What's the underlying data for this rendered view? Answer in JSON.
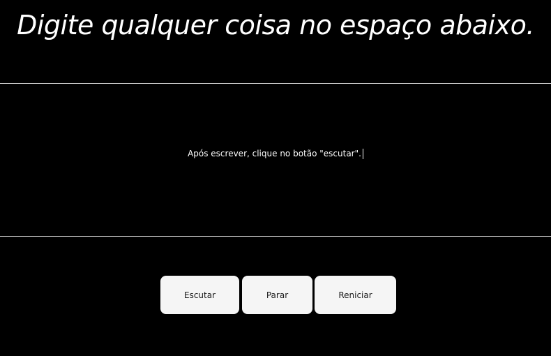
{
  "header": {
    "title": "Digite qualquer coisa no espaço abaixo."
  },
  "editor": {
    "text": "Após escrever, clique no botão \"escutar\"."
  },
  "controls": {
    "listen_label": "Escutar",
    "stop_label": "Parar",
    "restart_label": "Reniciar"
  }
}
